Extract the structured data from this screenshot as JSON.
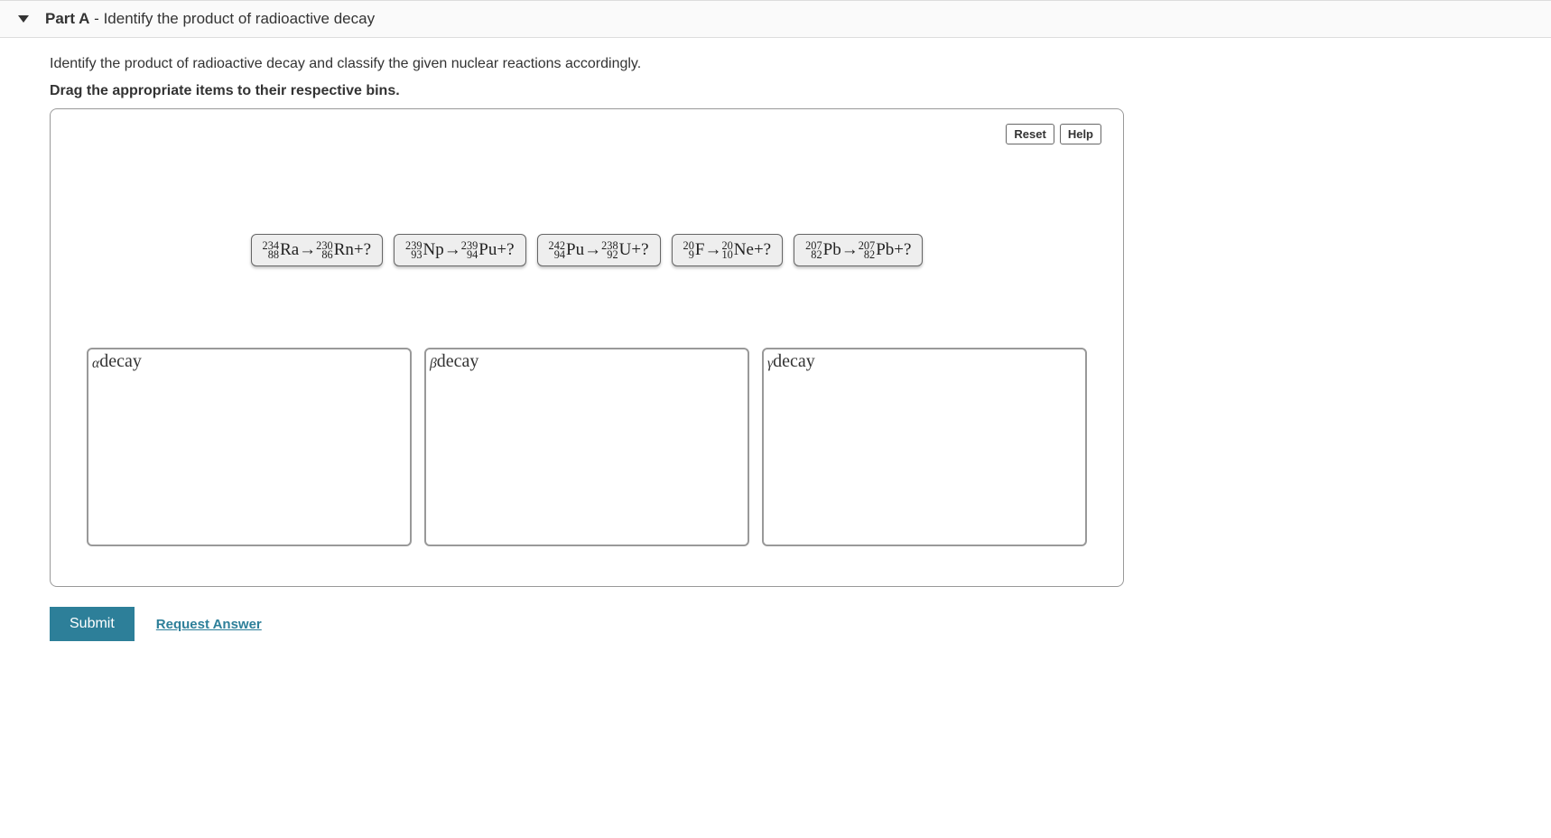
{
  "header": {
    "part_label": "Part A",
    "separator": " - ",
    "subtitle": "Identify the product of radioactive decay"
  },
  "body": {
    "intro": "Identify the product of radioactive decay and classify the given nuclear reactions accordingly.",
    "instruction": "Drag the appropriate items to their respective bins."
  },
  "controls": {
    "reset": "Reset",
    "help": "Help"
  },
  "items": [
    {
      "reactant": {
        "mass": "234",
        "atomic": "88",
        "symbol": "Ra"
      },
      "product": {
        "mass": "230",
        "atomic": "86",
        "symbol": "Rn"
      }
    },
    {
      "reactant": {
        "mass": "239",
        "atomic": "93",
        "symbol": "Np"
      },
      "product": {
        "mass": "239",
        "atomic": "94",
        "symbol": "Pu"
      }
    },
    {
      "reactant": {
        "mass": "242",
        "atomic": "94",
        "symbol": "Pu"
      },
      "product": {
        "mass": "238",
        "atomic": "92",
        "symbol": "U"
      }
    },
    {
      "reactant": {
        "mass": "20",
        "atomic": "9",
        "symbol": "F"
      },
      "product": {
        "mass": "20",
        "atomic": "10",
        "symbol": "Ne"
      }
    },
    {
      "reactant": {
        "mass": "207",
        "atomic": "82",
        "symbol": "Pb"
      },
      "product": {
        "mass": "207",
        "atomic": "82",
        "symbol": "Pb"
      }
    }
  ],
  "bins": [
    {
      "symbol": "α",
      "word": "decay"
    },
    {
      "symbol": "β",
      "word": "decay"
    },
    {
      "symbol": "γ",
      "word": "decay"
    }
  ],
  "footer": {
    "submit": "Submit",
    "request": "Request Answer"
  },
  "glue": {
    "arrow": "→",
    "plus_q": "+?"
  }
}
